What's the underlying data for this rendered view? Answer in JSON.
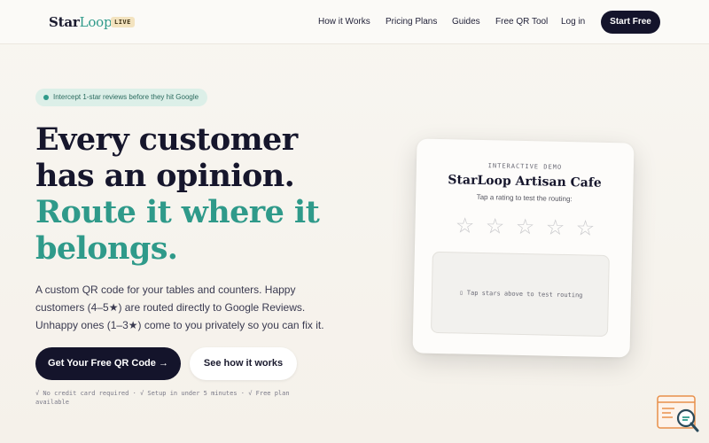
{
  "nav": {
    "logo_star": "Star",
    "logo_loop": "Loop",
    "live_badge": "LIVE",
    "links": [
      "How it Works",
      "Pricing Plans",
      "Guides",
      "Free QR Tool",
      "Log in"
    ],
    "start_button": "Start Free"
  },
  "hero": {
    "pill": "Intercept 1-star reviews before they hit Google",
    "headline_line1": "Every customer",
    "headline_line2": "has an opinion.",
    "headline_line3": "Route it where it",
    "headline_line4": "belongs.",
    "subcopy": "A custom QR code for your tables and counters. Happy customers (4–5★) are routed directly to Google Reviews. Unhappy ones (1–3★) come to you privately so you can fix it.",
    "cta_primary": "Get Your Free QR Code →",
    "cta_secondary": "See how it works",
    "fineprint": "√ No credit card required · √ Setup in under 5 minutes · √ Free plan available"
  },
  "demo": {
    "kicker": "INTERACTIVE DEMO",
    "title": "StarLoop Artisan Cafe",
    "subtitle": "Tap a rating to test the routing:",
    "star_count": 5,
    "star_glyph": "☆",
    "result_text": "▯ Tap stars above to test routing"
  },
  "colors": {
    "navy": "#14142b",
    "teal": "#2f9a8a",
    "badge": "#f3e3bf",
    "widget": "#e8904a"
  },
  "icons": {
    "pill_dot": "status-dot-icon",
    "widget": "search-help-icon"
  }
}
